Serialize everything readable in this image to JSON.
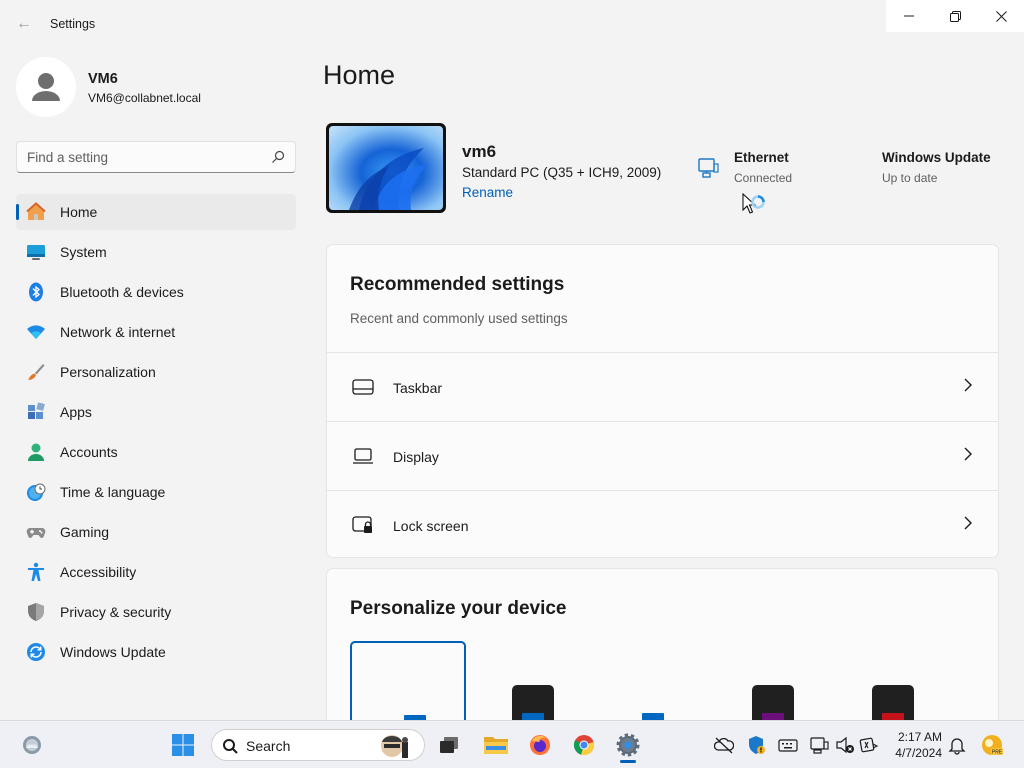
{
  "window": {
    "title": "Settings",
    "back": "←",
    "controls": {
      "minimize": "—",
      "maximize": "❐",
      "close": "✕"
    }
  },
  "profile": {
    "name": "VM6",
    "email": "VM6@collabnet.local"
  },
  "search": {
    "placeholder": "Find a setting"
  },
  "nav": {
    "items": [
      {
        "label": "Home",
        "icon": "home-icon",
        "active": true
      },
      {
        "label": "System",
        "icon": "system-icon"
      },
      {
        "label": "Bluetooth & devices",
        "icon": "bluetooth-icon"
      },
      {
        "label": "Network & internet",
        "icon": "wifi-icon"
      },
      {
        "label": "Personalization",
        "icon": "brush-icon"
      },
      {
        "label": "Apps",
        "icon": "apps-icon"
      },
      {
        "label": "Accounts",
        "icon": "accounts-icon"
      },
      {
        "label": "Time & language",
        "icon": "clock-globe-icon"
      },
      {
        "label": "Gaming",
        "icon": "gamepad-icon"
      },
      {
        "label": "Accessibility",
        "icon": "accessibility-icon"
      },
      {
        "label": "Privacy & security",
        "icon": "shield-icon"
      },
      {
        "label": "Windows Update",
        "icon": "update-icon"
      }
    ]
  },
  "main": {
    "title": "Home",
    "device": {
      "name": "vm6",
      "model": "Standard PC (Q35 + ICH9, 2009)",
      "rename": "Rename"
    },
    "ethernet": {
      "title": "Ethernet",
      "status": "Connected"
    },
    "windows_update": {
      "title": "Windows Update",
      "status": "Up to date"
    },
    "recommended": {
      "title": "Recommended settings",
      "subtitle": "Recent and commonly used settings",
      "items": [
        {
          "label": "Taskbar",
          "icon": "taskbar-icon"
        },
        {
          "label": "Display",
          "icon": "laptop-icon"
        },
        {
          "label": "Lock screen",
          "icon": "lock-screen-icon"
        }
      ]
    },
    "personalize": {
      "title": "Personalize your device",
      "themes": [
        {
          "background": "#fbfbfb",
          "accent": "#0067c0",
          "selected": true
        },
        {
          "background": "#202020",
          "accent": "#0067c0"
        },
        {
          "background": "#fbfbfb",
          "accent": "#0067c0"
        },
        {
          "background": "#202020",
          "accent": "#6b0f7c"
        },
        {
          "background": "#202020",
          "accent": "#c4121b"
        }
      ]
    }
  },
  "taskbar": {
    "search_label": "Search",
    "time": "2:17 AM",
    "date": "4/7/2024",
    "accent": "#005fb8"
  }
}
